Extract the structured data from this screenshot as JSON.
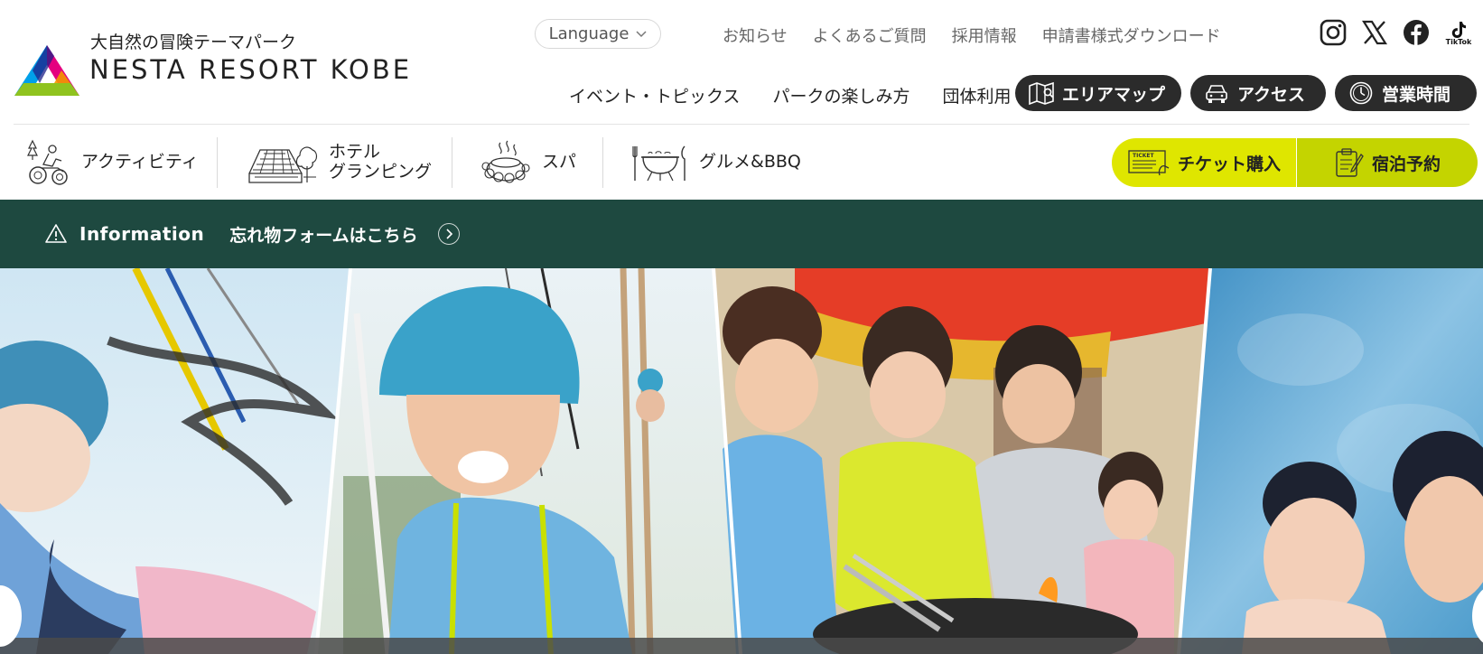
{
  "brand": {
    "tagline": "大自然の冒険テーマパーク",
    "name": "NESTA RESORT KOBE"
  },
  "language": {
    "label": "Language"
  },
  "utility_links": [
    "お知らせ",
    "よくあるご質問",
    "採用情報",
    "申請書様式ダウンロード"
  ],
  "social": {
    "tiktok_label": "TikTok"
  },
  "main_nav": [
    "イベント・トピックス",
    "パークの楽しみ方",
    "団体利用"
  ],
  "pills": {
    "area_map": "エリアマップ",
    "access": "アクセス",
    "hours": "営業時間"
  },
  "categories": {
    "activity": "アクティビティ",
    "hotel_line1": "ホテル",
    "hotel_line2": "グランピング",
    "spa": "スパ",
    "gourmet": "グルメ&BBQ"
  },
  "cta": {
    "ticket": "チケット購入",
    "ticket_badge": "TICKET",
    "hotel": "宿泊予約"
  },
  "info": {
    "title": "Information",
    "link": "忘れ物フォームはこちら"
  },
  "colors": {
    "info_bar": "#1e4940",
    "ticket_cta": "#dfe600",
    "hotel_cta": "#c4d400",
    "pill_dark": "#2b2b2b"
  }
}
